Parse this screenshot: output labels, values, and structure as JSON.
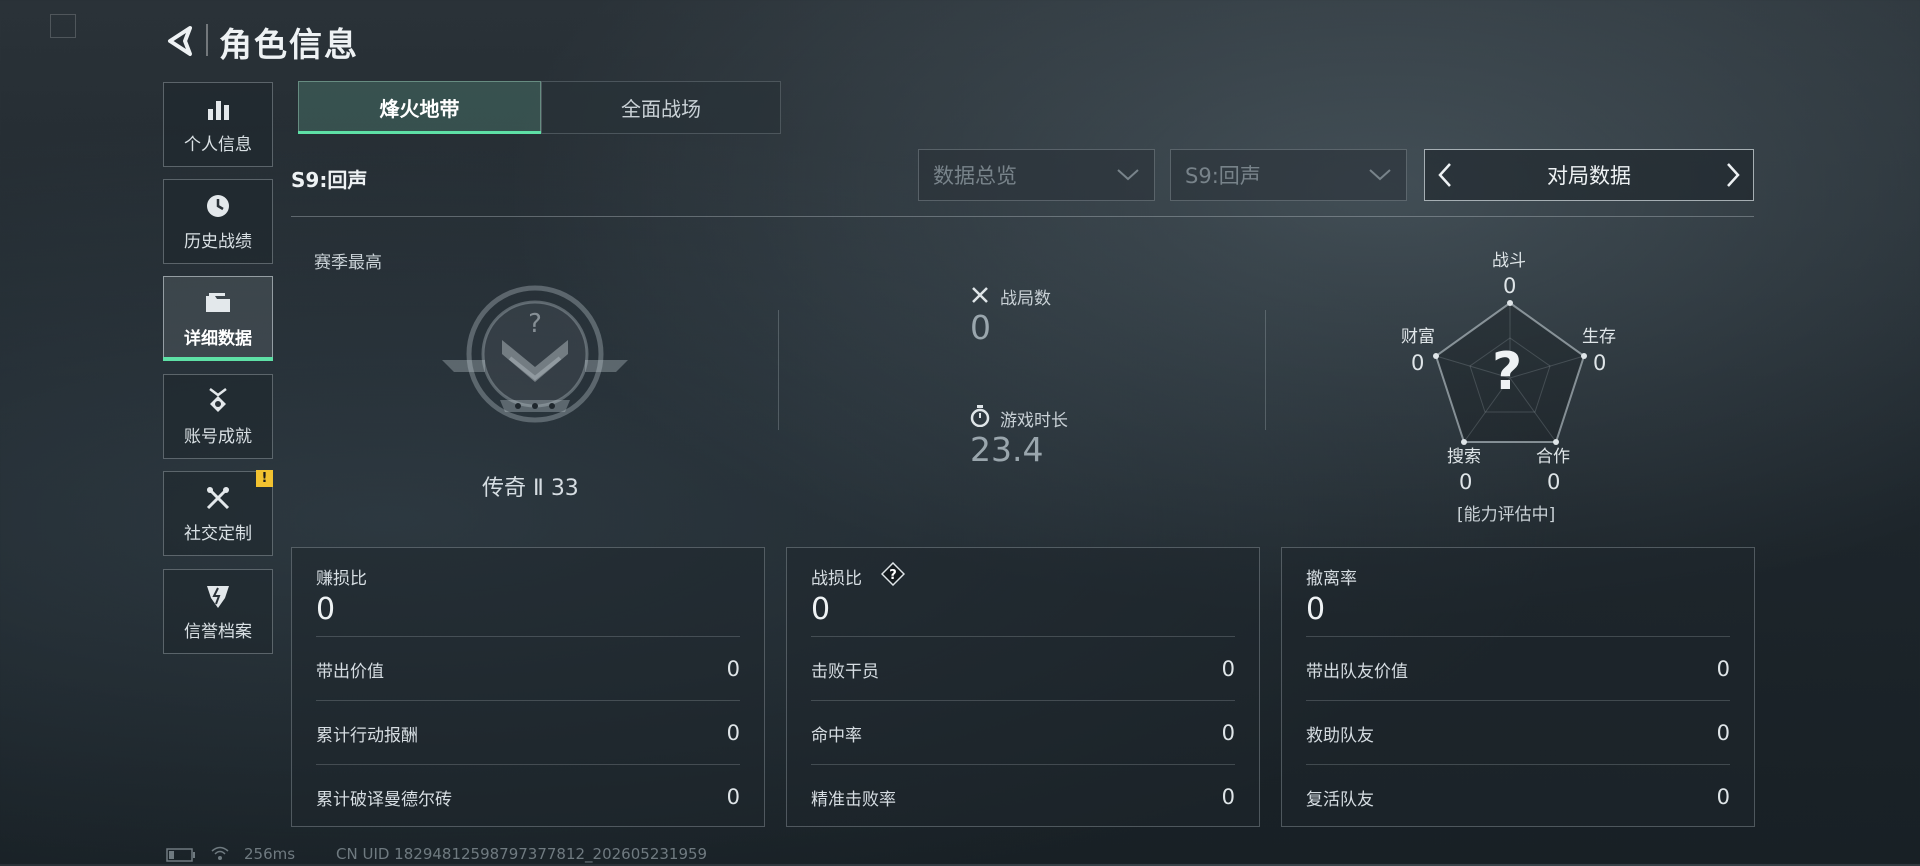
{
  "header": {
    "title": "角色信息"
  },
  "sidebar": {
    "items": [
      {
        "label": "个人信息"
      },
      {
        "label": "历史战绩"
      },
      {
        "label": "详细数据"
      },
      {
        "label": "账号成就"
      },
      {
        "label": "社交定制"
      },
      {
        "label": "信誉档案"
      }
    ],
    "badge": "!"
  },
  "tabs": [
    {
      "label": "烽火地带"
    },
    {
      "label": "全面战场"
    }
  ],
  "season": {
    "label": "S9:回声"
  },
  "filters": {
    "dropdown1": "数据总览",
    "dropdown2": "S9:回声",
    "match_selector": "对局数据"
  },
  "rank": {
    "label": "赛季最高",
    "name": "传奇 Ⅱ 33"
  },
  "stats": {
    "battles_label": "战局数",
    "battles_value": "0",
    "playtime_label": "游戏时长",
    "playtime_value": "23.4"
  },
  "radar": {
    "center": "?",
    "combat_label": "战斗",
    "combat_value": "0",
    "survival_label": "生存",
    "survival_value": "0",
    "coop_label": "合作",
    "coop_value": "0",
    "search_label": "搜索",
    "search_value": "0",
    "wealth_label": "财富",
    "wealth_value": "0",
    "status": "[能力评估中]"
  },
  "cards": [
    {
      "title": "赚损比",
      "value": "0",
      "rows": [
        {
          "label": "带出价值",
          "value": "0"
        },
        {
          "label": "累计行动报酬",
          "value": "0"
        },
        {
          "label": "累计破译曼德尔砖",
          "value": "0"
        }
      ]
    },
    {
      "title": "战损比",
      "help": "?",
      "value": "0",
      "rows": [
        {
          "label": "击败干员",
          "value": "0"
        },
        {
          "label": "命中率",
          "value": "0"
        },
        {
          "label": "精准击败率",
          "value": "0"
        }
      ]
    },
    {
      "title": "撤离率",
      "value": "0",
      "rows": [
        {
          "label": "带出队友价值",
          "value": "0"
        },
        {
          "label": "救助队友",
          "value": "0"
        },
        {
          "label": "复活队友",
          "value": "0"
        }
      ]
    }
  ],
  "footer": {
    "ping": "256ms",
    "uid": "CN UID 18294812598797377812_202605231959"
  }
}
